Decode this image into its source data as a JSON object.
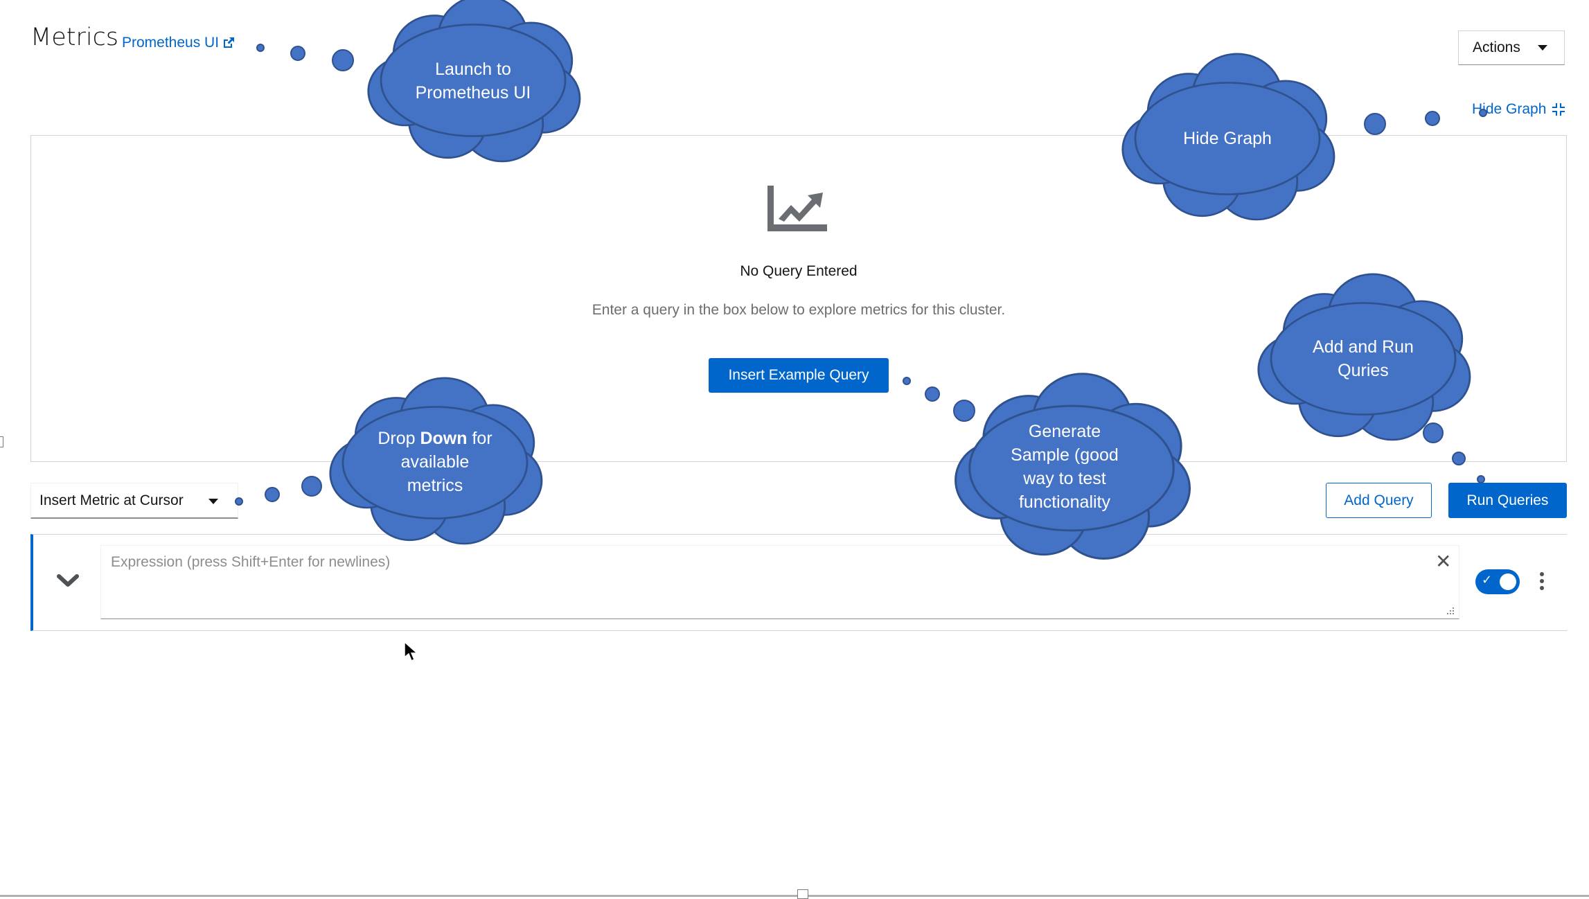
{
  "header": {
    "title": "Metrics",
    "prometheus_link": "Prometheus UI",
    "actions_label": "Actions"
  },
  "graph": {
    "hide_graph_label": "Hide Graph",
    "empty_title": "No Query Entered",
    "empty_body": "Enter a query in the box below to explore metrics for this cluster.",
    "example_button": "Insert Example Query"
  },
  "toolbar": {
    "insert_metric_label": "Insert Metric at Cursor",
    "add_query_label": "Add Query",
    "run_queries_label": "Run Queries"
  },
  "query": {
    "placeholder": "Expression (press Shift+Enter for newlines)",
    "enabled": true
  },
  "callouts": {
    "launch": "Launch to Prometheus UI",
    "hide_graph": "Hide Graph",
    "add_run": "Add and Run Quries",
    "drop_down_pre": "Drop ",
    "drop_down_bold": "Down",
    "drop_down_post": " for available metrics",
    "generate": "Generate Sample (good way to test functionality"
  },
  "colors": {
    "link": "#0066cc",
    "primary": "#0066cc",
    "callout_fill": "#4472c4",
    "callout_stroke": "#2f528f"
  },
  "icons": {
    "external_link": "external-link-icon",
    "compress": "compress-icon",
    "chart_area": "chart-area-icon",
    "chevron": "chevron-down-icon",
    "close": "close-icon",
    "kebab": "kebab-icon"
  }
}
